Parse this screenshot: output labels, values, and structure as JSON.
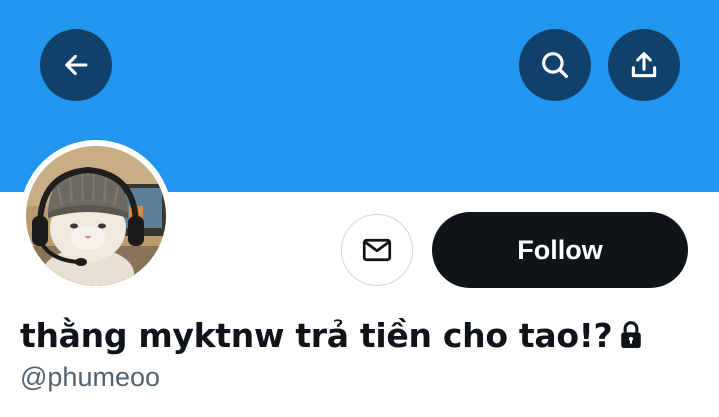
{
  "colors": {
    "banner": "#2196ee",
    "button_bg": "#10416b",
    "follow_bg": "#0f1419",
    "name_text": "#0f1419",
    "handle_text": "#536471"
  },
  "header": {
    "back_icon": "arrow-left-icon",
    "search_icon": "search-icon",
    "share_icon": "share-upload-icon"
  },
  "profile": {
    "display_name": "thằng myktnw trả tiền cho tao!?",
    "protected_icon": "lock-icon",
    "handle": "@phumeoo",
    "avatar_icon": "avatar-cat-with-headset"
  },
  "actions": {
    "message_icon": "envelope-icon",
    "follow_label": "Follow"
  }
}
